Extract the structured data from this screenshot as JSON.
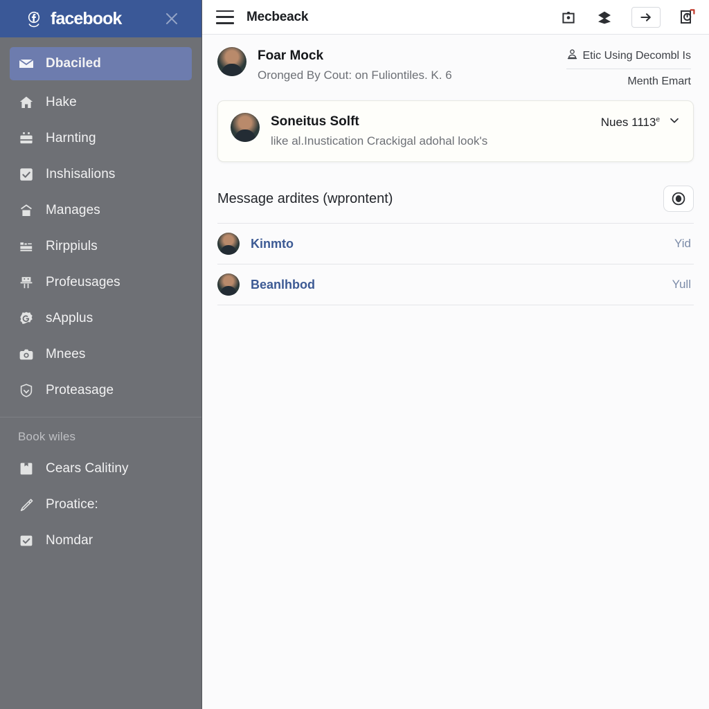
{
  "sidebar": {
    "brand": {
      "name": "facebook",
      "mark_icon": "facebook-f-icon",
      "close_icon": "close-icon",
      "bar_color": "#3a5897"
    },
    "active_item": {
      "label": "Dbaciled",
      "icon": "envelope-icon"
    },
    "items": [
      {
        "label": "Hake",
        "icon": "home-icon"
      },
      {
        "label": "Harnting",
        "icon": "briefcase-icon"
      },
      {
        "label": "Inshisalions",
        "icon": "checkbox-checked-icon"
      },
      {
        "label": "Manages",
        "icon": "chart-box-icon"
      },
      {
        "label": "Rirppiuls",
        "icon": "card-list-icon"
      },
      {
        "label": "Profeusages",
        "icon": "people-icon"
      },
      {
        "label": "sApplus",
        "icon": "g-badge-icon"
      },
      {
        "label": "Mnees",
        "icon": "camera-icon"
      },
      {
        "label": "Proteasage",
        "icon": "shield-icon"
      }
    ],
    "section_label": "Book wiles",
    "section_items": [
      {
        "label": "Cears Calitiny",
        "icon": "save-icon"
      },
      {
        "label": "Proatice:",
        "icon": "pen-icon"
      },
      {
        "label": "Nomdar",
        "icon": "checkbox-check-icon"
      }
    ]
  },
  "topbar": {
    "menu_icon": "hamburger-icon",
    "title": "Mecbeack",
    "actions": [
      {
        "name": "camera-icon"
      },
      {
        "name": "layers-icon"
      },
      {
        "name": "arrow-right-icon"
      },
      {
        "name": "refresh-clock-icon"
      }
    ]
  },
  "messages": {
    "primary": {
      "name": "Foar Mock",
      "subtitle": "Oronged By Cout: on Fuliontiles. K. 6",
      "meta_icon": "user-icon",
      "meta_top": "Etic Using Decombl Is",
      "meta_bottom": "Menth Emart"
    },
    "card": {
      "name": "Soneitus Solft",
      "subtitle": "like al.Inustication Crackigal adohal look's",
      "time": "Nues 1113",
      "time_sup": "e",
      "chevron_icon": "chevron-down-icon"
    }
  },
  "section": {
    "title": "Message ardites (wprontent)",
    "action_icon": "record-circle-icon"
  },
  "list": [
    {
      "name": "Kinmto",
      "action": "Yid",
      "avatar": "avatar"
    },
    {
      "name": "Beanlhbod",
      "action": "Yull",
      "avatar": "avatar"
    }
  ],
  "colors": {
    "facebook_blue": "#3a5897",
    "sidebar_gray": "#6e7075",
    "active_highlight": "#6d7cae",
    "link_blue": "#3c5a94"
  }
}
